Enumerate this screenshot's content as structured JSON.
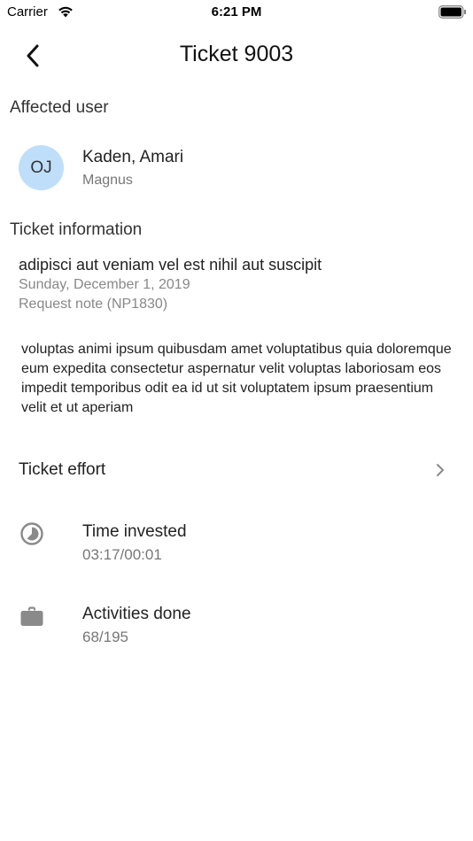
{
  "status_bar": {
    "carrier": "Carrier",
    "time": "6:21 PM"
  },
  "header": {
    "title": "Ticket 9003",
    "back_icon": "chevron-left-icon"
  },
  "affected_user": {
    "section_label": "Affected user",
    "initials": "OJ",
    "name": "Kaden, Amari",
    "organization": "Magnus",
    "avatar_color": "#bfdef9"
  },
  "ticket_info": {
    "section_label": "Ticket information",
    "subject": "adipisci aut veniam vel est nihil aut suscipit",
    "date": "Sunday, December 1, 2019",
    "request": "Request note (NP1830)",
    "description": "voluptas animi ipsum quibusdam amet voluptatibus quia doloremque eum expedita consectetur aspernatur velit voluptas laboriosam eos impedit temporibus odit ea id ut sit voluptatem ipsum praesentium velit et ut aperiam"
  },
  "effort": {
    "label": "Ticket effort",
    "chevron_icon": "chevron-right-icon"
  },
  "metrics": {
    "time_invested": {
      "label": "Time invested",
      "value": "03:17/00:01",
      "icon": "timelapse-icon"
    },
    "activities_done": {
      "label": "Activities done",
      "value": "68/195",
      "icon": "briefcase-icon"
    }
  },
  "colors": {
    "icon_gray": "#8a8a8a",
    "secondary_text": "#777777"
  }
}
